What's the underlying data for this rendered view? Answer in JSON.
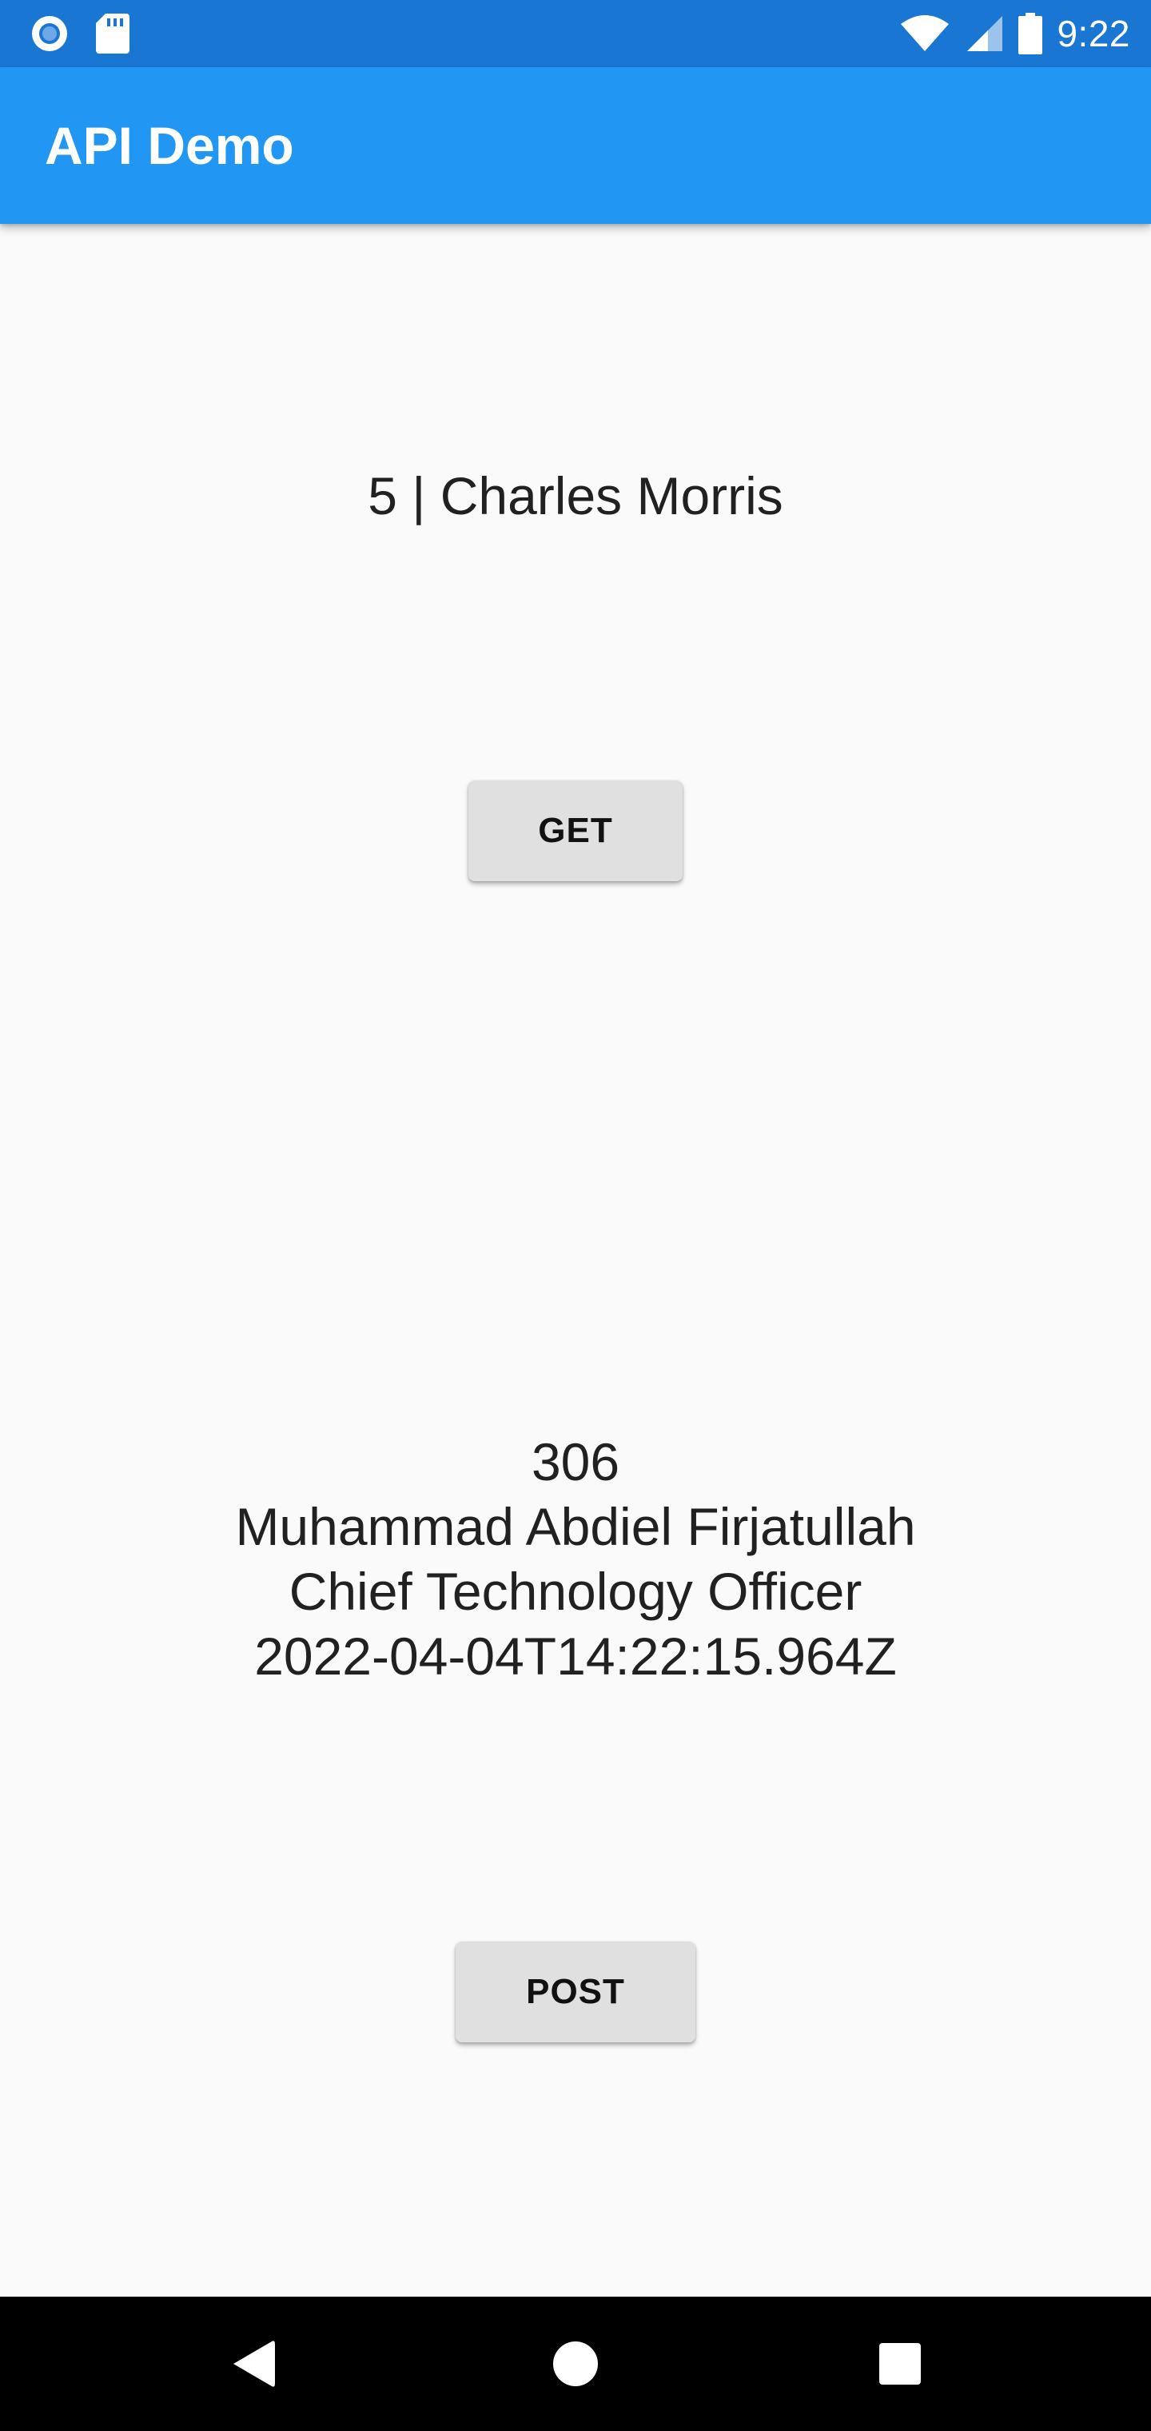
{
  "status_bar": {
    "time": "9:22",
    "left_icons": [
      "record-icon",
      "sd-card-icon"
    ],
    "right_icons": [
      "wifi-icon",
      "cell-signal-icon",
      "battery-icon"
    ],
    "color": "#1976d2"
  },
  "app_bar": {
    "title": "API Demo",
    "color": "#2196f3"
  },
  "get_section": {
    "result": "5 | Charles Morris",
    "button_label": "GET"
  },
  "post_section": {
    "result_lines": [
      "306",
      "Muhammad Abdiel Firjatullah",
      "Chief Technology Officer",
      "2022-04-04T14:22:15.964Z"
    ],
    "button_label": "POST"
  },
  "nav_bar": {
    "buttons": [
      "back-icon",
      "home-icon",
      "recents-icon"
    ]
  }
}
